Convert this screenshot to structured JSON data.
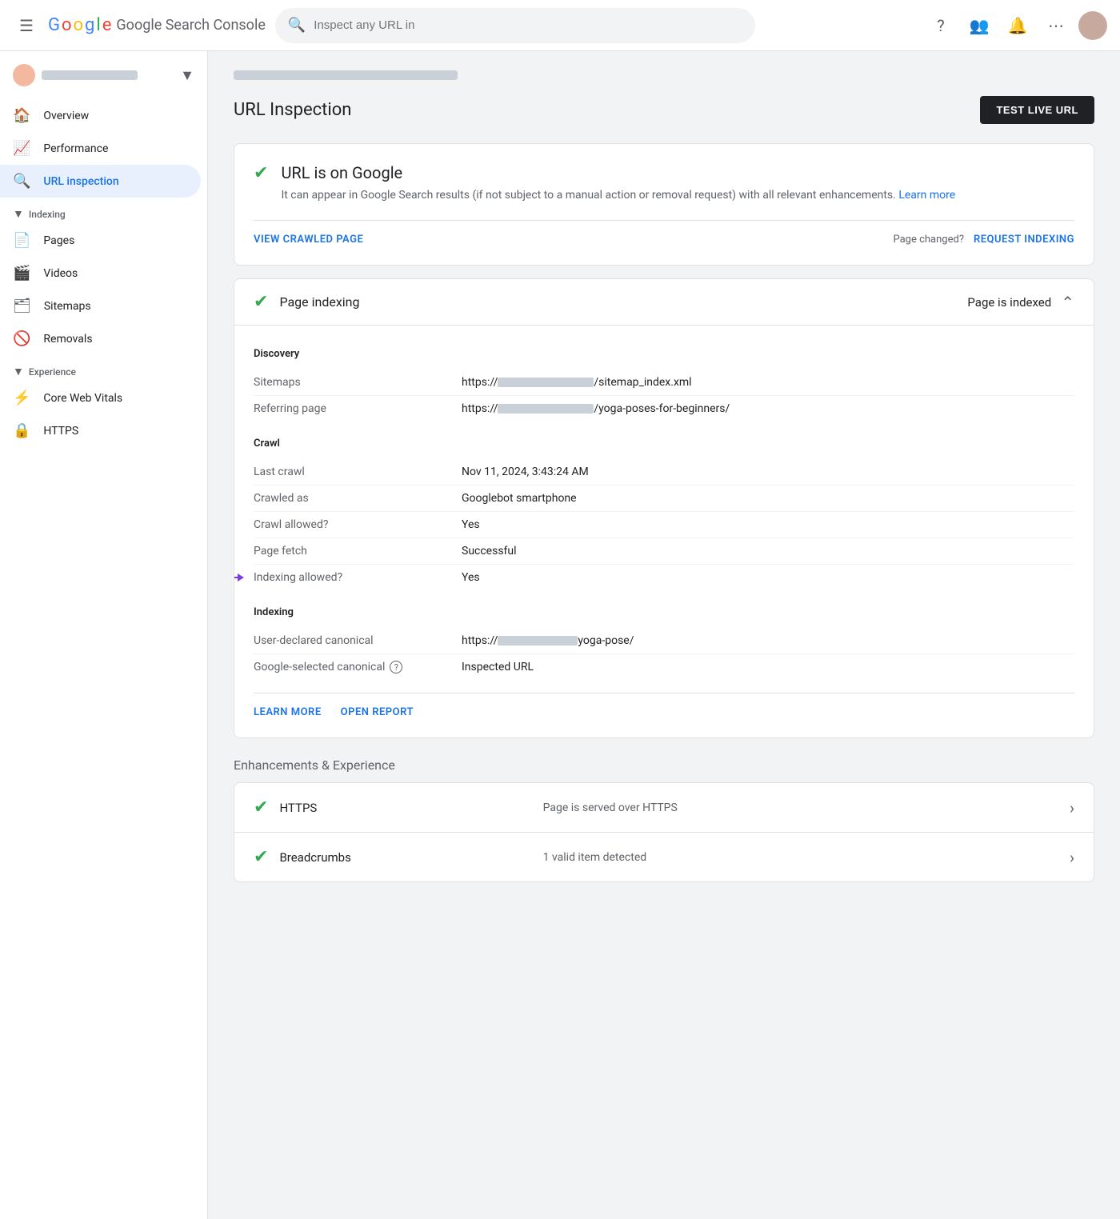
{
  "topbar": {
    "app_name": "Google Search Console",
    "search_placeholder": "Inspect any URL in",
    "logo_letters": [
      {
        "letter": "G",
        "color_class": "g-blue"
      },
      {
        "letter": "o",
        "color_class": "g-red"
      },
      {
        "letter": "o",
        "color_class": "g-yellow"
      },
      {
        "letter": "g",
        "color_class": "g-blue"
      },
      {
        "letter": "l",
        "color_class": "g-green"
      },
      {
        "letter": "e",
        "color_class": "g-red"
      }
    ]
  },
  "sidebar": {
    "property_name": "blurred-property",
    "nav_items": [
      {
        "id": "overview",
        "label": "Overview",
        "icon": "🏠"
      },
      {
        "id": "performance",
        "label": "Performance",
        "icon": "📈"
      },
      {
        "id": "url-inspection",
        "label": "URL inspection",
        "icon": "🔍",
        "active": true
      }
    ],
    "indexing_section": {
      "label": "Indexing",
      "items": [
        {
          "id": "pages",
          "label": "Pages",
          "icon": "📄"
        },
        {
          "id": "videos",
          "label": "Videos",
          "icon": "🎬"
        },
        {
          "id": "sitemaps",
          "label": "Sitemaps",
          "icon": "🗂"
        },
        {
          "id": "removals",
          "label": "Removals",
          "icon": "🚫"
        }
      ]
    },
    "experience_section": {
      "label": "Experience",
      "items": [
        {
          "id": "core-web-vitals",
          "label": "Core Web Vitals",
          "icon": "⚡"
        },
        {
          "id": "https",
          "label": "HTTPS",
          "icon": "🔒"
        }
      ]
    }
  },
  "breadcrumb": "blurred-url-text",
  "page": {
    "title": "URL Inspection",
    "test_live_btn": "TEST LIVE URL"
  },
  "status_card": {
    "title": "URL is on Google",
    "description": "It can appear in Google Search results (if not subject to a manual action or removal request) with all relevant enhancements.",
    "learn_more": "Learn more",
    "view_crawled": "VIEW CRAWLED PAGE",
    "page_changed_label": "Page changed?",
    "request_indexing": "REQUEST INDEXING"
  },
  "indexing_section": {
    "title": "Page indexing",
    "status": "Page is indexed",
    "discovery": {
      "label": "Discovery",
      "rows": [
        {
          "label": "Sitemaps",
          "value_prefix": "https://",
          "value_blurred": true,
          "value_suffix": "/sitemap_index.xml"
        },
        {
          "label": "Referring page",
          "value_prefix": "https://",
          "value_blurred": true,
          "value_suffix": "/yoga-poses-for-beginners/"
        }
      ]
    },
    "crawl": {
      "label": "Crawl",
      "rows": [
        {
          "label": "Last crawl",
          "value": "Nov 11, 2024, 3:43:24 AM"
        },
        {
          "label": "Crawled as",
          "value": "Googlebot smartphone"
        },
        {
          "label": "Crawl allowed?",
          "value": "Yes"
        },
        {
          "label": "Page fetch",
          "value": "Successful"
        },
        {
          "label": "Indexing allowed?",
          "value": "Yes",
          "has_arrow": true
        }
      ]
    },
    "indexing_group": {
      "label": "Indexing",
      "rows": [
        {
          "label": "User-declared canonical",
          "value_prefix": "https://",
          "value_blurred": true,
          "value_suffix": "yoga-pose/"
        },
        {
          "label": "Google-selected canonical",
          "has_help": true,
          "value": "Inspected URL"
        }
      ]
    },
    "learn_more": "LEARN MORE",
    "open_report": "OPEN REPORT"
  },
  "enhancements": {
    "section_title": "Enhancements & Experience",
    "items": [
      {
        "id": "https-item",
        "name": "HTTPS",
        "status": "Page is served over HTTPS",
        "status_ok": true
      },
      {
        "id": "breadcrumbs-item",
        "name": "Breadcrumbs",
        "status": "1 valid item detected",
        "status_ok": true
      }
    ]
  }
}
